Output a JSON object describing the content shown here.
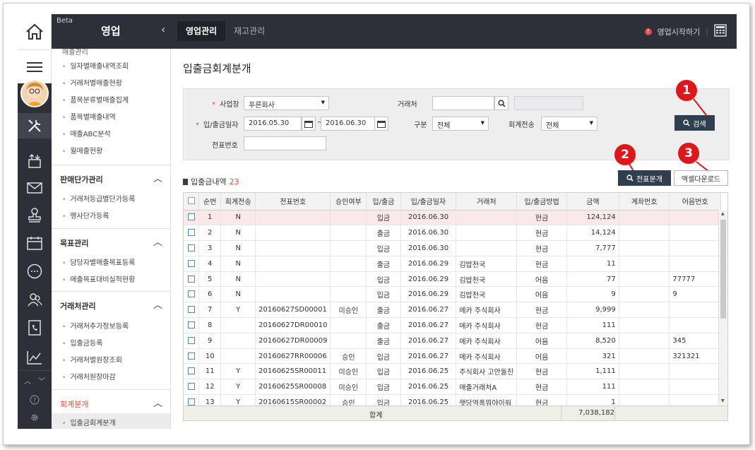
{
  "header": {
    "beta": "Beta",
    "app_name": "영업",
    "tabs": [
      {
        "label": "영업관리",
        "active": true
      },
      {
        "label": "재고관리",
        "active": false
      }
    ],
    "start_link": "영업시작하기"
  },
  "sidebar": {
    "cut_item": "매출관리",
    "section1_items": [
      "일자별매출내역조회",
      "거래처별매출현황",
      "품목분류별매출집계",
      "품목별매출내역",
      "매출ABC분석",
      "월매출현황"
    ],
    "groups": [
      {
        "title": "판매단가관리",
        "items": [
          "거래처등급별단가등록",
          "행사단가등록"
        ]
      },
      {
        "title": "목표관리",
        "items": [
          "담당자별매출목표등록",
          "매출목표대비실적현황"
        ]
      },
      {
        "title": "거래처관리",
        "items": [
          "거래처추가정보등록",
          "입출금등록",
          "거래처별원장조회",
          "거래처원장마감"
        ]
      },
      {
        "title": "회계분개",
        "items": [
          "입출금회계분개"
        ]
      }
    ]
  },
  "page": {
    "title": "입출금회계분개"
  },
  "search": {
    "business_label": "사업장",
    "business_value": "푸른회사",
    "customer_label": "거래처",
    "customer_value": "",
    "date_label": "입/출금일자",
    "date_from": "2016.05.30",
    "date_tilde": "~",
    "date_to": "2016.06.30",
    "type_label": "구분",
    "type_value": "전체",
    "accounting_label": "회계전송",
    "accounting_value": "전체",
    "voucher_label": "전표번호",
    "voucher_value": "",
    "search_button": "검색"
  },
  "list": {
    "title": "입출금내역",
    "count": "23",
    "journal_button": "전표분개",
    "excel_button": "엑셀다운로드"
  },
  "callouts": [
    "1",
    "2",
    "3"
  ],
  "table": {
    "columns": [
      "순번",
      "회계전송",
      "전표번호",
      "승인여부",
      "입/출금",
      "입/출금일자",
      "거래처",
      "입/출금방법",
      "금액",
      "계좌번호",
      "어음번호"
    ],
    "rows": [
      [
        "1",
        "N",
        "",
        "",
        "입금",
        "2016.06.30",
        "",
        "현금",
        "124,124",
        "",
        ""
      ],
      [
        "2",
        "N",
        "",
        "",
        "출금",
        "2016.06.30",
        "",
        "현금",
        "14,124",
        "",
        ""
      ],
      [
        "3",
        "N",
        "",
        "",
        "입금",
        "2016.06.30",
        "",
        "현금",
        "7,777",
        "",
        ""
      ],
      [
        "4",
        "N",
        "",
        "",
        "출금",
        "2016.06.29",
        "김밥천국",
        "현금",
        "11",
        "",
        ""
      ],
      [
        "5",
        "N",
        "",
        "",
        "입금",
        "2016.06.29",
        "김밥천국",
        "어음",
        "77",
        "",
        "77777"
      ],
      [
        "6",
        "N",
        "",
        "",
        "입금",
        "2016.06.29",
        "김밥천국",
        "어음",
        "9",
        "",
        "9"
      ],
      [
        "7",
        "Y",
        "20160627SD00001",
        "미승인",
        "출금",
        "2016.06.27",
        "메카 주식회사",
        "현금",
        "9,999",
        "",
        ""
      ],
      [
        "8",
        "",
        "20160627DR00010",
        "",
        "출금",
        "2016.06.27",
        "메카 주식회사",
        "현금",
        "111",
        "",
        ""
      ],
      [
        "9",
        "",
        "20160627DR00009",
        "",
        "출금",
        "2016.06.27",
        "메카 주식회사",
        "어음",
        "8,520",
        "",
        "345"
      ],
      [
        "10",
        "",
        "20160627RR00006",
        "승인",
        "입금",
        "2016.06.27",
        "메카 주식회사",
        "어음",
        "321",
        "",
        "321321"
      ],
      [
        "11",
        "Y",
        "20160625SR00011",
        "미승인",
        "입금",
        "2016.06.25",
        "주식회사 고안돌친",
        "현금",
        "1,111",
        "",
        ""
      ],
      [
        "12",
        "Y",
        "20160625SR00008",
        "미승인",
        "입금",
        "2016.06.25",
        "매출거래처A",
        "현금",
        "111",
        "",
        ""
      ],
      [
        "13",
        "Y",
        "20160615SR00002",
        "승인",
        "입금",
        "2016.06.25",
        "햇당역폭뭐야이워",
        "현금",
        "1",
        "",
        ""
      ]
    ],
    "total_label": "합계",
    "total_amount": "7,038,182"
  },
  "colors": {
    "dark": "#2d3038",
    "accent_red": "#e24a3b",
    "callout_red": "#e0161b",
    "button_dark": "#2f3f50",
    "selected_row": "#fbe9ea"
  },
  "icons": [
    "home-icon",
    "hamburger-icon",
    "tools-icon",
    "transfer-icon",
    "mail-icon",
    "stamp-icon",
    "calendar-icon",
    "chat-icon",
    "people-icon",
    "phone-book-icon",
    "chart-icon",
    "chevron-up-icon",
    "chevron-down-icon",
    "help-icon",
    "gear-icon",
    "calculator-icon",
    "alert-icon",
    "search-icon"
  ]
}
